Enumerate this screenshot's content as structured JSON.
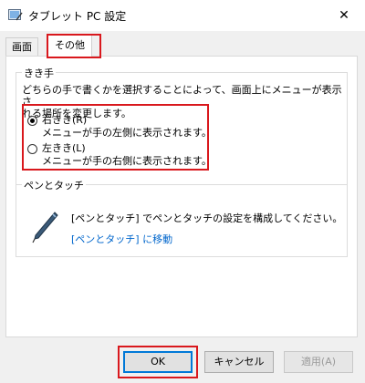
{
  "window": {
    "title": "タブレット PC 設定",
    "close_glyph": "✕"
  },
  "tabs": [
    {
      "label": "画面"
    },
    {
      "label": "その他",
      "selected": true
    }
  ],
  "handedness": {
    "legend": "きき手",
    "description_line1": "どちらの手で書くかを選択することによって、画面上にメニューが表示さ",
    "description_line2": "れる場所を変更します。",
    "options": [
      {
        "label": "右きき(R)",
        "description": "メニューが手の左側に表示されます。",
        "checked": true
      },
      {
        "label": "左きき(L)",
        "description": "メニューが手の右側に表示されます。",
        "checked": false
      }
    ]
  },
  "pen_touch": {
    "legend": "ペンとタッチ",
    "description": "[ペンとタッチ] でペンとタッチの設定を構成してください。",
    "link": "[ペンとタッチ] に移動"
  },
  "buttons": {
    "ok": "OK",
    "cancel": "キャンセル",
    "apply": "適用(A)"
  },
  "colors": {
    "highlight_red": "#d9181d",
    "link_blue": "#0066cc",
    "default_button_border": "#0078d7"
  }
}
